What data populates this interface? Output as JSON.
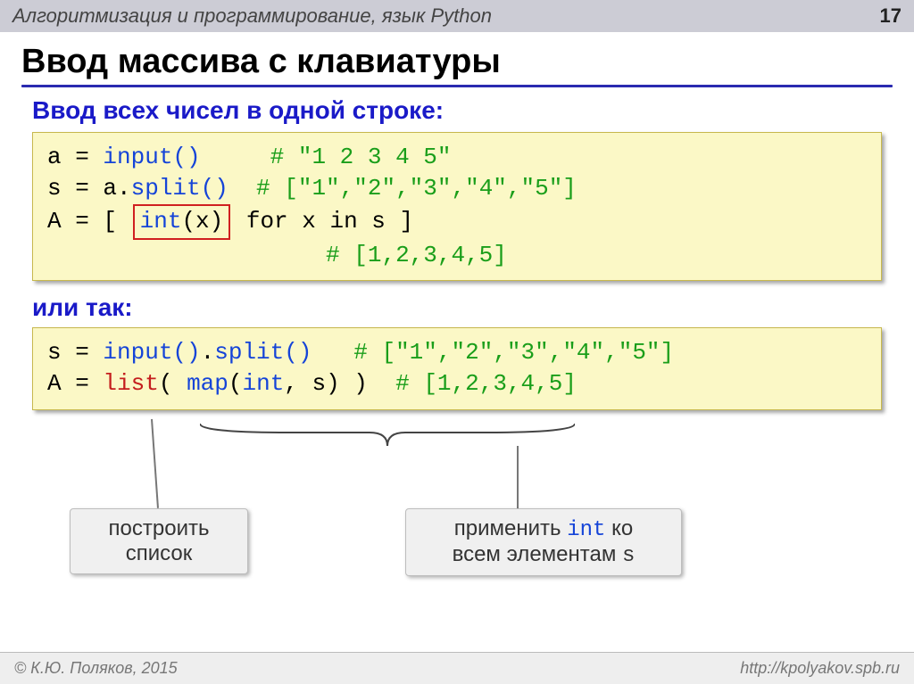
{
  "header": {
    "topic": "Алгоритмизация и программирование, язык Python",
    "page": "17"
  },
  "title": "Ввод массива с клавиатуры",
  "subhead1": "Ввод всех чисел в одной строке:",
  "code1": {
    "l1_a": "a",
    "l1_eq": " = ",
    "l1_fn": "input()",
    "l1_cm": "     # \"1 2 3 4 5\"",
    "l2_a": "s",
    "l2_eq": " = a.",
    "l2_fn": "split()",
    "l2_cm": "  # [\"1\",\"2\",\"3\",\"4\",\"5\"]",
    "l3_pre": "A = [ ",
    "l3_box_fn": "int",
    "l3_box_arg": "(x)",
    "l3_mid": " for x in s ]",
    "l4_cm": "                    # [1,2,3,4,5]"
  },
  "or_text": "или так:",
  "code2": {
    "l1_a": "s",
    "l1_eq": " = ",
    "l1_fn": "input()",
    "l1_dot": ".",
    "l1_fn2": "split()",
    "l1_cm": "   # [\"1\",\"2\",\"3\",\"4\",\"5\"]",
    "l2_a": "A",
    "l2_eq": " = ",
    "l2_list": "list",
    "l2_open": "( ",
    "l2_map": "map",
    "l2_args": "(",
    "l2_int": "int",
    "l2_rest": ", s) )  ",
    "l2_cm": "# [1,2,3,4,5]"
  },
  "callouts": {
    "left_l1": "построить",
    "left_l2": "список",
    "right_pre": "применить ",
    "right_int": "int",
    "right_post": " ко",
    "right_l2_pre": "всем элементам ",
    "right_s": "s"
  },
  "footer": {
    "copyright": "© К.Ю. Поляков, 2015",
    "url": "http://kpolyakov.spb.ru"
  }
}
